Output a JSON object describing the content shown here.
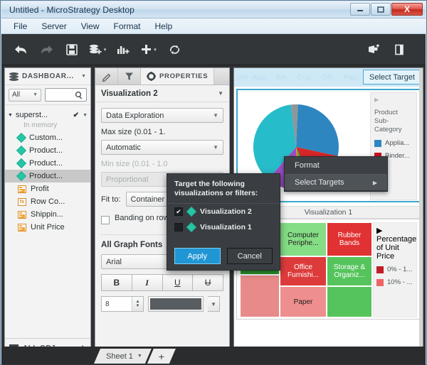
{
  "window": {
    "title": "Untitled - MicroStrategy Desktop",
    "buttons": {
      "minimize": "—",
      "maximize": "▣",
      "close": "X"
    }
  },
  "menubar": {
    "items": [
      "File",
      "Server",
      "View",
      "Format",
      "Help"
    ]
  },
  "toolbar": {
    "items": [
      {
        "name": "undo-icon",
        "label": "Undo"
      },
      {
        "name": "redo-icon",
        "label": "Redo"
      },
      {
        "name": "save-icon",
        "label": "Save"
      },
      {
        "name": "add-data-icon",
        "label": "Add Data"
      },
      {
        "name": "add-visualization-icon",
        "label": "Add Visualization"
      },
      {
        "name": "add-icon",
        "label": "Add"
      },
      {
        "name": "refresh-icon",
        "label": "Refresh"
      },
      {
        "name": "share-icon",
        "label": "Share"
      },
      {
        "name": "panel-icon",
        "label": "Panel"
      }
    ]
  },
  "dataset_panel": {
    "header": "DASHBOAR...",
    "filter_select": "All",
    "search_placeholder": "",
    "root": {
      "label": "superst...",
      "status": "In memory"
    },
    "items": [
      {
        "label": "Custom...",
        "type": "attribute-diamond",
        "selected": false
      },
      {
        "label": "Product...",
        "type": "attribute-diamond",
        "selected": false
      },
      {
        "label": "Product...",
        "type": "attribute-diamond",
        "selected": false
      },
      {
        "label": "Product...",
        "type": "attribute-diamond",
        "selected": true
      },
      {
        "label": "Profit",
        "type": "metric",
        "selected": false
      },
      {
        "label": "Row Co...",
        "type": "derived-metric",
        "selected": false
      },
      {
        "label": "Shippin...",
        "type": "metric",
        "selected": false
      },
      {
        "label": "Unit Price",
        "type": "metric",
        "selected": false
      }
    ],
    "footer": {
      "label": "ALL OBJ...",
      "add": "+"
    }
  },
  "properties": {
    "tabs": [
      {
        "name": "editor-tab",
        "icon": "pencil-icon",
        "label": "",
        "active": false
      },
      {
        "name": "filters-tab",
        "icon": "funnel-icon",
        "label": "",
        "active": false
      },
      {
        "name": "properties-tab",
        "icon": "gear-icon",
        "label": "PROPERTIES",
        "active": true
      }
    ],
    "target_name": "Visualization 2",
    "fields": {
      "data_exploration": "Data Exploration",
      "max_size_label": "Max size (0.01 - 1.",
      "max_size_value": "Automatic",
      "min_size_label": "Min size (0.01 - 1.0",
      "min_size_value": "Proportional",
      "fit_to_label": "Fit to:",
      "fit_to_value": "Container",
      "banding_label": "Banding on rows"
    },
    "fonts": {
      "group_title": "All Graph Fonts",
      "family": "Arial",
      "bold": "B",
      "italic": "I",
      "underline": "U",
      "strikethrough": "U",
      "size": "8",
      "color": "#575d60"
    }
  },
  "canvas": {
    "filter_bar": {
      "items": [
        "(All",
        "App...",
        "Bin...",
        "Cop...",
        "Offi...",
        "Pap..."
      ]
    },
    "select_target_button": "Select Target",
    "viz1_header": "Visualization 1"
  },
  "context_menu": {
    "items": [
      {
        "label": "Format",
        "has_submenu": false,
        "highlighted": false
      },
      {
        "label": "Select Targets",
        "has_submenu": true,
        "highlighted": true,
        "arrow": "▶"
      }
    ]
  },
  "target_dialog": {
    "title": "Target the following visualizations or filters:",
    "options": [
      {
        "label": "Visualization 2",
        "checked": true,
        "check": "✔"
      },
      {
        "label": "Visualization 1",
        "checked": false,
        "check": ""
      }
    ],
    "apply_label": "Apply",
    "cancel_label": "Cancel"
  },
  "sheet_bar": {
    "sheet_label": "Sheet 1",
    "add_label": "+"
  },
  "chart_data": [
    {
      "type": "pie",
      "title": "Visualization 2",
      "legend_title": "Product Sub-Category",
      "legend_position": "right",
      "legend_entries": [
        {
          "label": "Applia...",
          "color": "#2e86c1"
        },
        {
          "label": "Binder...",
          "color": "#cc1122"
        }
      ],
      "slices": [
        {
          "label": "Applia...",
          "value": 45,
          "color": "#2e86c1"
        },
        {
          "label": "Binder...",
          "value": 11,
          "color": "#d62728"
        },
        {
          "label": "slice-green",
          "value": 3,
          "color": "#27a844"
        },
        {
          "label": "slice-orange",
          "value": 3,
          "color": "#f39019"
        },
        {
          "label": "slice-purple",
          "value": 10,
          "color": "#9b4fc4"
        },
        {
          "label": "slice-cyan",
          "value": 26,
          "color": "#27bcc9"
        },
        {
          "label": "slice-gray",
          "value": 2,
          "color": "#8e9699"
        }
      ]
    },
    {
      "type": "treemap",
      "title": "Visualization 1",
      "legend_title": "Percentage of Unit Price",
      "legend_position": "right",
      "legend_entries": [
        {
          "label": "0% - 1...",
          "color": "#c21c26"
        },
        {
          "label": "10% - ...",
          "color": "#ef6565"
        }
      ],
      "cells": [
        {
          "label": "",
          "value": 18,
          "color": "#2ca02c",
          "text_color": "#ffffff"
        },
        {
          "label": "",
          "value": 16,
          "color": "#e88a8a",
          "text_color": "#333333"
        },
        {
          "label": "Computer Periphe...",
          "value": 14,
          "color": "#85dd85",
          "text_color": "#1d1d1d"
        },
        {
          "label": "Office Furnishi...",
          "value": 12,
          "color": "#dd3b3b",
          "text_color": "#ffffff"
        },
        {
          "label": "Paper",
          "value": 13,
          "color": "#ef8e8e",
          "text_color": "#1d1d1d"
        },
        {
          "label": "Rubber Bands",
          "value": 11,
          "color": "#e03232",
          "text_color": "#ffffff"
        },
        {
          "label": "Storage & Organiz...",
          "value": 10,
          "color": "#56c45c",
          "text_color": "#ffffff"
        },
        {
          "label": "",
          "value": 9,
          "color": "#56c45c",
          "text_color": "#ffffff"
        }
      ]
    }
  ]
}
